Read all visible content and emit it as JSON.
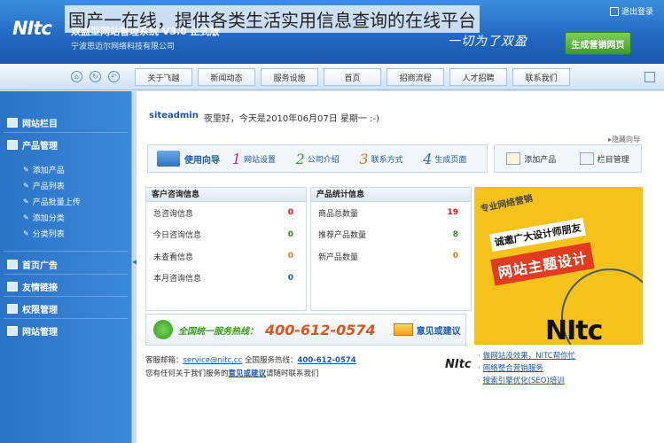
{
  "overlay_caption": "国产一在线，提供各类生活实用信息查询的在线平台",
  "header": {
    "logo": "NItc",
    "product_name": "双盟型网站管理系统 V3.0 正式版",
    "company_name": "宁波思迈尔网络科技有限公司",
    "slogan": "一切为了双盈",
    "exit_label": "退出登录",
    "generate_button": "生成营销网页"
  },
  "nav": {
    "tabs": [
      "关于飞越",
      "新闻动态",
      "服务设施",
      "首页",
      "招商流程",
      "人才招聘",
      "联系我们"
    ],
    "icons": [
      "home-icon",
      "refresh-icon",
      "back-icon"
    ]
  },
  "sidebar": {
    "sections": [
      {
        "label": "网站栏目",
        "icon": "folder-icon"
      },
      {
        "label": "产品管理",
        "icon": "product-icon"
      },
      {
        "label": "首页广告",
        "icon": "ad-icon"
      },
      {
        "label": "友情链接",
        "icon": "link-icon"
      },
      {
        "label": "权限管理",
        "icon": "permission-icon"
      },
      {
        "label": "网站管理",
        "icon": "site-icon"
      }
    ],
    "product_items": [
      "添加产品",
      "产品列表",
      "产品批量上传",
      "添加分类",
      "分类列表"
    ]
  },
  "welcome": {
    "user": "siteadmin",
    "greeting": "夜里好，今天是2010年06月07日 星期一 :-)"
  },
  "hide_guide": "▸隐藏向导",
  "guide": {
    "title": "使用向导",
    "steps": [
      {
        "num": "1",
        "label": "网站设置"
      },
      {
        "num": "2",
        "label": "公司介绍"
      },
      {
        "num": "3",
        "label": "联系方式"
      },
      {
        "num": "4",
        "label": "生成页面"
      }
    ]
  },
  "quick": {
    "add_product": "添加产品",
    "column_manage": "栏目管理"
  },
  "customer_info": {
    "title": "客户咨询信息",
    "rows": [
      {
        "label": "总咨询信息",
        "value": "0"
      },
      {
        "label": "今日咨询信息",
        "value": "0"
      },
      {
        "label": "未查看信息",
        "value": "0"
      },
      {
        "label": "本月咨询信息",
        "value": "0"
      }
    ]
  },
  "product_stats": {
    "title": "产品统计信息",
    "rows": [
      {
        "label": "商品总数量",
        "value": "19"
      },
      {
        "label": "推荐产品数量",
        "value": "8"
      },
      {
        "label": "新产品数量",
        "value": "0"
      }
    ]
  },
  "ad": {
    "line1": "专业网络营销",
    "line2": "诚邀广大设计师朋友",
    "line3": "网站主题设计",
    "circle_text": "New Internet Trade Center",
    "brand": "NItc"
  },
  "hotline": {
    "label": "全国统一服务热线：",
    "number": "400-612-0574",
    "suggest": "意见或建议"
  },
  "contact": {
    "email_label": "客服邮箱：",
    "email": "service@nitc.cc",
    "hotline_label": "全国服务热线：",
    "hotline": "400-612-0574",
    "line2_prefix": "您有任何关于我们服务的",
    "suggest_link": "意见或建议",
    "line2_suffix": "请随时联系我们"
  },
  "footer_brand": "NItc",
  "footer_links": [
    "做网站没效果，NITC帮你忙",
    "网络整合营销服务",
    "搜索引擎优化(SEO)培训"
  ]
}
